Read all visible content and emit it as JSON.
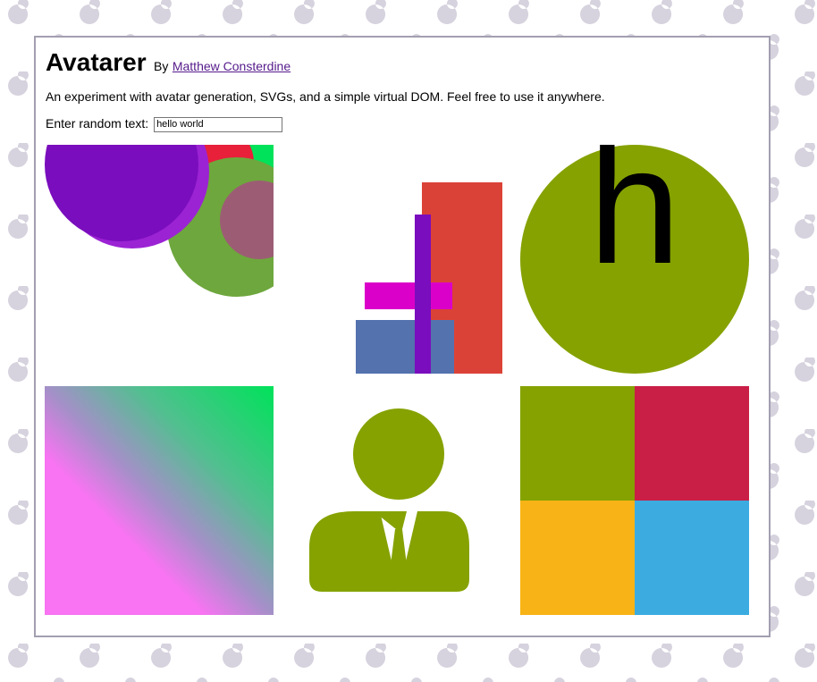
{
  "header": {
    "title": "Avatarer",
    "by_label": "By",
    "author_link": "Matthew Consterdine"
  },
  "description": "An experiment with avatar generation, SVGs, and a simple virtual DOM. Feel free to use it anywhere.",
  "input": {
    "label": "Enter random text:",
    "value": "hello world"
  },
  "avatars": {
    "letter_glyph": "h"
  },
  "colors": {
    "background_dots": "#d6d2de",
    "card_border": "#a39fb0",
    "olive": "#85a201",
    "crimson": "#c91f46",
    "amber": "#f8b416",
    "sky": "#3cace0",
    "purple": "#7a0dbd",
    "violet": "#9b23d4",
    "red": "#e8203a",
    "green": "#00e25a",
    "moss": "#6ea73d",
    "mauve": "#9c5d74",
    "brick": "#db4237",
    "magenta": "#db00c9",
    "slate_blue": "#5472ae",
    "pink": "#f874f2"
  }
}
